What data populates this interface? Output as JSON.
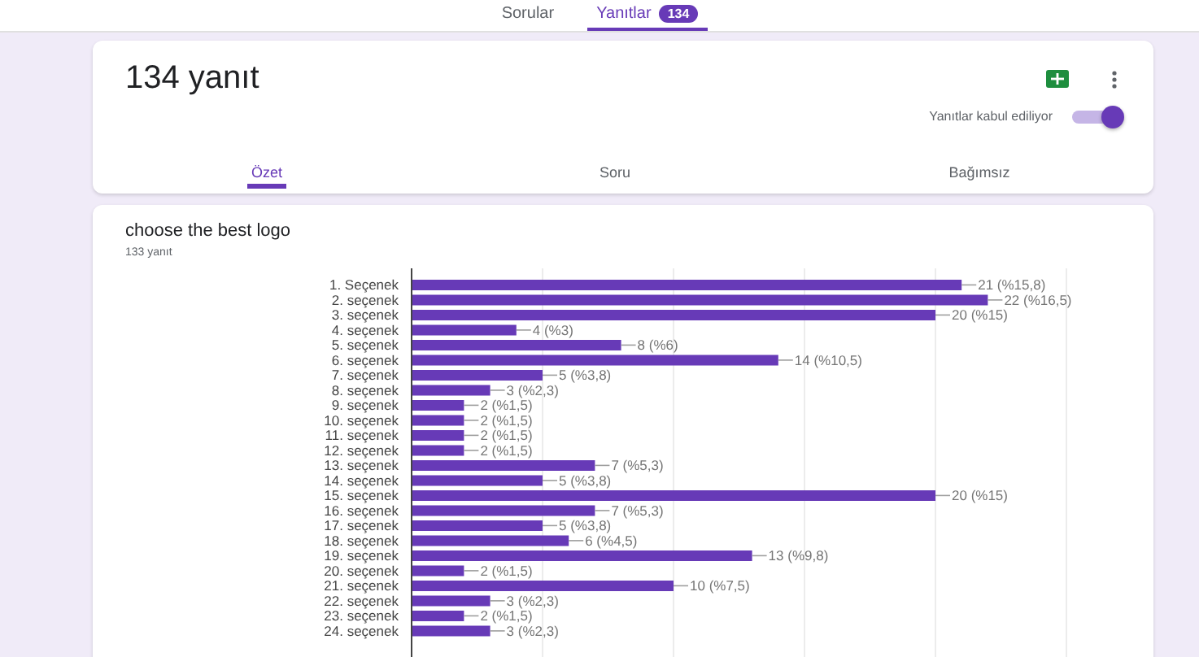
{
  "top_tabs": [
    {
      "label": "Sorular",
      "selected": false
    },
    {
      "label": "Yanıtlar",
      "badge": "134",
      "selected": true
    }
  ],
  "header": {
    "title": "134 yanıt",
    "accepting_label": "Yanıtlar kabul ediliyor",
    "accepting_on": true
  },
  "view_tabs": [
    {
      "label": "Özet",
      "selected": true
    },
    {
      "label": "Soru",
      "selected": false
    },
    {
      "label": "Bağımsız",
      "selected": false
    }
  ],
  "question": {
    "title": "choose the best logo",
    "count": "133 yanıt",
    "chart_data": {
      "type": "bar",
      "orientation": "horizontal",
      "categories": [
        "1. Seçenek",
        "2. seçenek",
        "3. seçenek",
        "4. seçenek",
        "5. seçenek",
        "6. seçenek",
        "7. seçenek",
        "8. seçenek",
        "9. seçenek",
        "10. seçenek",
        "11. seçenek",
        "12. seçenek",
        "13. seçenek",
        "14. seçenek",
        "15. seçenek",
        "16. seçenek",
        "17. seçenek",
        "18. seçenek",
        "19. seçenek",
        "20. seçenek",
        "21. seçenek",
        "22. seçenek",
        "23. seçenek",
        "24. seçenek"
      ],
      "values": [
        21,
        22,
        20,
        4,
        8,
        14,
        5,
        3,
        2,
        2,
        2,
        2,
        7,
        5,
        20,
        7,
        5,
        6,
        13,
        2,
        10,
        3,
        2,
        3
      ],
      "value_labels": [
        "21 (%15,8)",
        "22 (%16,5)",
        "20 (%15)",
        "4 (%3)",
        "8 (%6)",
        "14 (%10,5)",
        "5 (%3,8)",
        "3 (%2,3)",
        "2 (%1,5)",
        "2 (%1,5)",
        "2 (%1,5)",
        "2 (%1,5)",
        "7 (%5,3)",
        "5 (%3,8)",
        "20 (%15)",
        "7 (%5,3)",
        "5 (%3,8)",
        "6 (%4,5)",
        "13 (%9,8)",
        "2 (%1,5)",
        "10 (%7,5)",
        "3 (%2,3)",
        "2 (%1,5)",
        "3 (%2,3)"
      ]
    }
  }
}
